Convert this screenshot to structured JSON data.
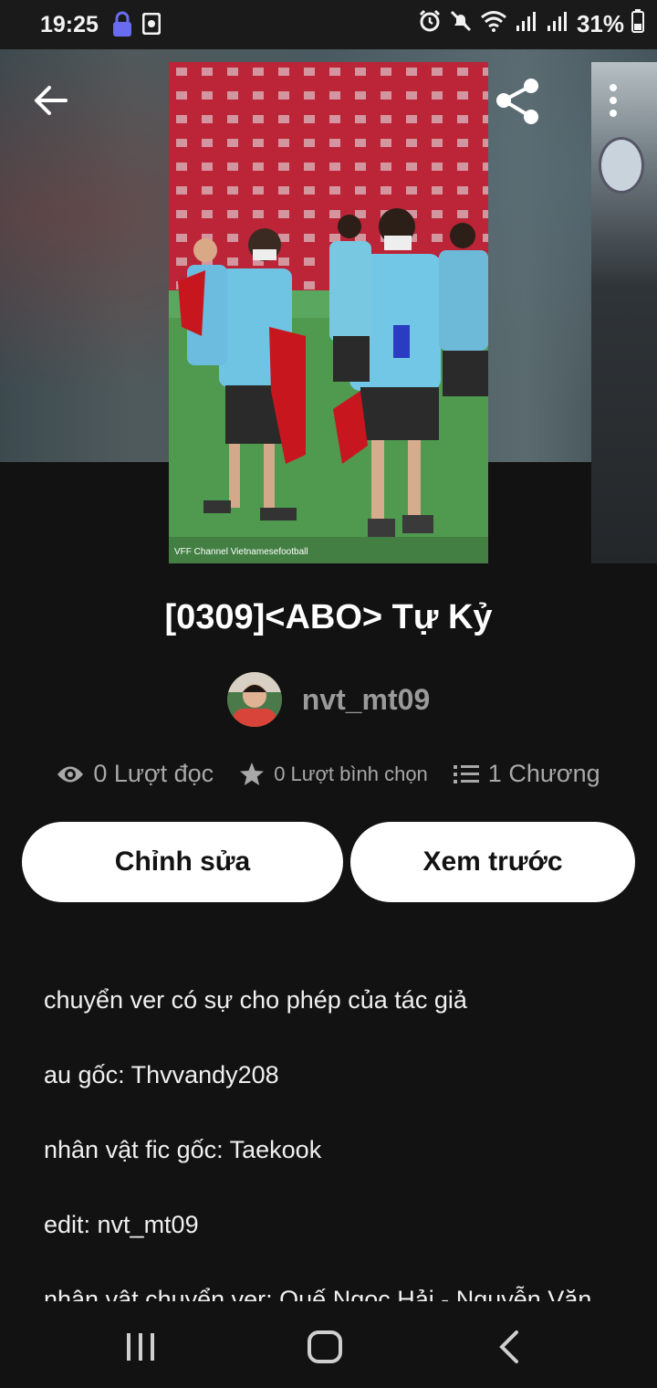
{
  "status_bar": {
    "time": "19:25",
    "battery": "31%",
    "icons": [
      "lock-icon",
      "screen-record-icon",
      "alarm-icon",
      "mute-icon",
      "wifi-icon",
      "signal-icon",
      "signal-icon",
      "battery-icon"
    ]
  },
  "header": {
    "back_icon": "arrow-left-icon",
    "share_icon": "share-icon",
    "menu_icon": "more-vert-icon"
  },
  "cover": {
    "watermark": "VFF Channel  Vietnamesefootball"
  },
  "story": {
    "title": "[0309]<ABO> Tự Kỷ",
    "author": "nvt_mt09"
  },
  "stats": {
    "reads": "0 Lượt đọc",
    "votes": "0 Lượt bình chọn",
    "chapters": "1 Chương"
  },
  "buttons": {
    "edit": "Chỉnh sửa",
    "preview": "Xem trước"
  },
  "description": [
    "chuyển ver có sự cho phép của tác giả",
    "au gốc: Thvvandy208",
    "nhân vật fic gốc: Taekook",
    "edit: nvt_mt09",
    "nhân vật chuyển ver: Quế Ngọc Hải - Nguyễn Văn"
  ],
  "colors": {
    "background": "#121212",
    "button_bg": "#ffffff",
    "muted_text": "#a8a8a8"
  }
}
